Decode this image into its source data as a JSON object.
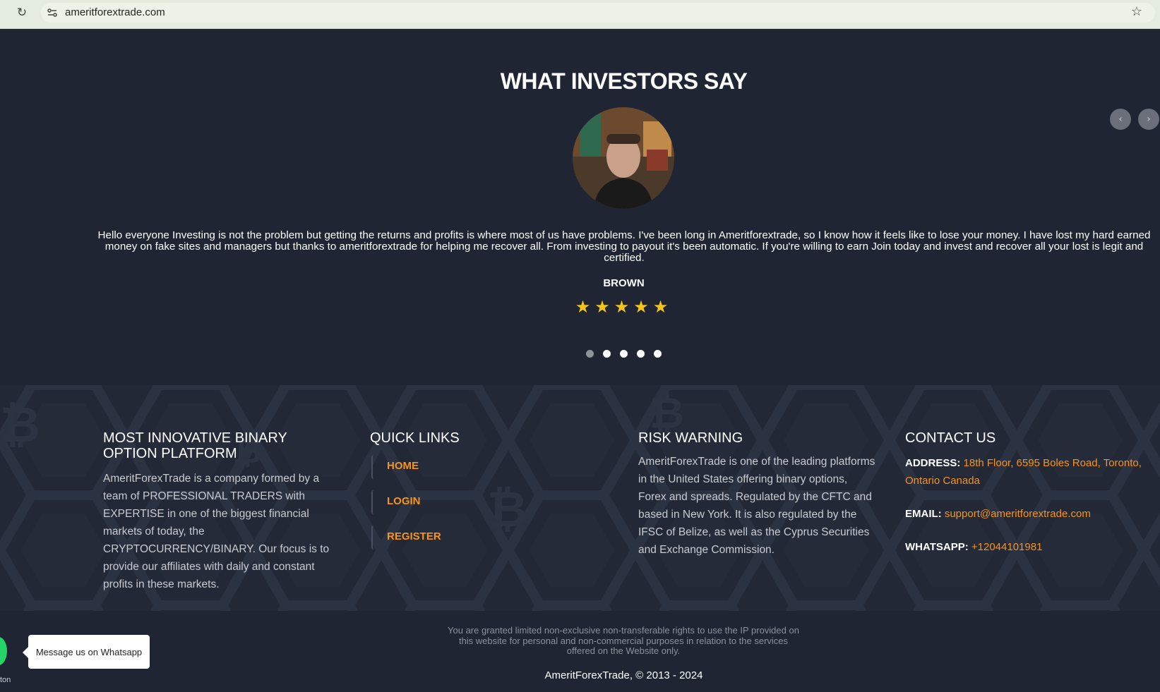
{
  "browser": {
    "url": "ameritforextrade.com"
  },
  "testimonial": {
    "title": "WHAT INVESTORS SAY",
    "quote": "Hello everyone Investing is not the problem but getting the returns and profits is where most of us have problems. I've been long in Ameritforextrade, so I know how it feels like to lose your money. I have lost my hard earned money on fake sites and managers but thanks to ameritforextrade for helping me recover all. From investing to payout it's been automatic. If you're willing to earn Join today and invest and recover all your lost is legit and certified.",
    "author": "BROWN",
    "stars": "★★★★★",
    "rating": 5,
    "slides_total": 5,
    "active_slide": 1
  },
  "footer": {
    "about": {
      "title": "MOST INNOVATIVE BINARY OPTION PLATFORM",
      "text": "AmeritForexTrade is a company formed by a team of PROFESSIONAL TRADERS with EXPERTISE in one of the biggest financial markets of today, the CRYPTOCURRENCY/BINARY. Our focus is to provide our affiliates with daily and constant profits in these markets."
    },
    "quick_links": {
      "title": "QUICK LINKS",
      "home": "HOME",
      "login": "LOGIN",
      "register": "REGISTER"
    },
    "risk": {
      "title": "RISK WARNING",
      "text": "AmeritForexTrade is one of the leading platforms in the United States offering binary options, Forex and spreads. Regulated by the CFTC and based in New York. It is also regulated by the IFSC of Belize, as well as the Cyprus Securities and Exchange Commission."
    },
    "contact": {
      "title": "CONTACT US",
      "address_label": "ADDRESS:",
      "address": "18th Floor, 6595 Boles Road, Toronto, Ontario Canada",
      "email_label": "EMAIL:",
      "email": "support@ameritforextrade.com",
      "whatsapp_label": "WHATSAPP:",
      "whatsapp": "+12044101981"
    }
  },
  "bottom": {
    "disclaimer": "You are granted limited non-exclusive non-transferable rights to use the IP provided on this website for personal and non-commercial purposes in relation to the services offered on the Website only.",
    "copyright": "AmeritForexTrade, © 2013 - 2024"
  },
  "whatsapp_widget": {
    "bubble": "Message us on Whatsapp",
    "caption": "ton"
  },
  "colors": {
    "background": "#1f2532",
    "accent": "#f7941d",
    "star": "#f5c518",
    "browser_bar": "#e4ecdf"
  }
}
